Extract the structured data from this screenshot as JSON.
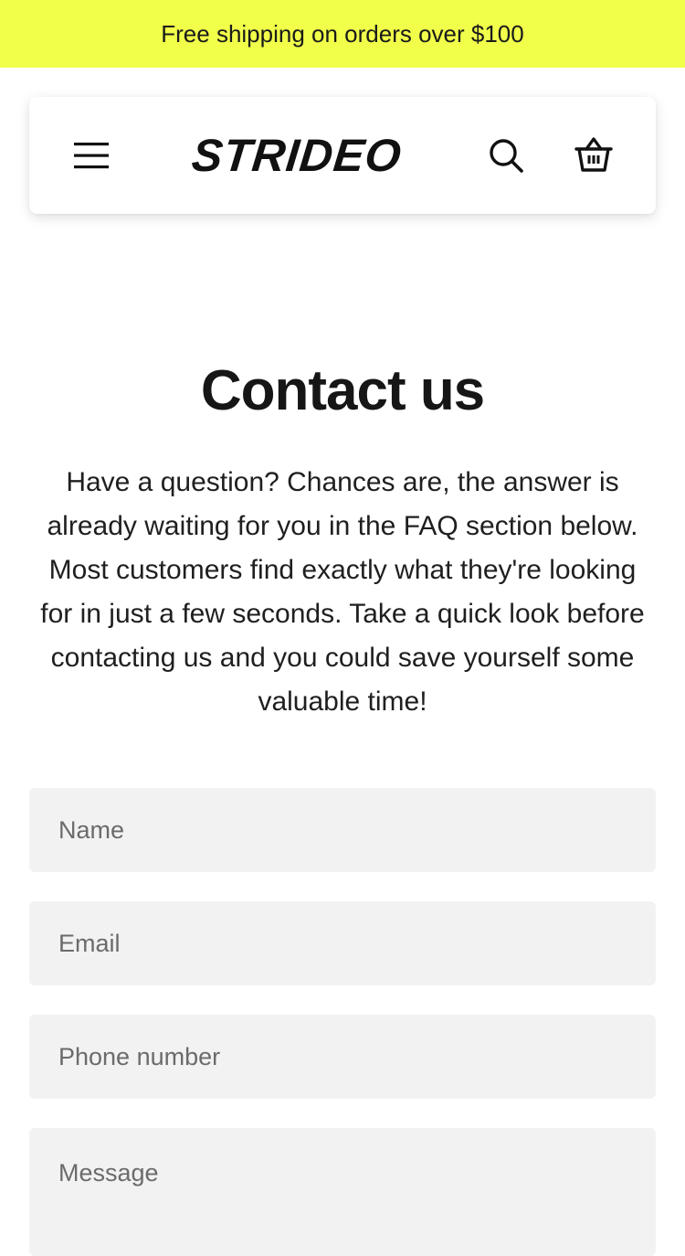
{
  "announcement": {
    "text": "Free shipping on orders over $100"
  },
  "header": {
    "logo": "STRIDEO",
    "icons": {
      "menu": "hamburger-menu-icon",
      "search": "search-icon",
      "cart": "shopping-basket-icon"
    }
  },
  "contact": {
    "title": "Contact us",
    "intro": "Have a question? Chances are, the answer is already waiting for you in the FAQ section below. Most customers find exactly what they're looking for in just a few seconds. Take a quick look before contacting us and you could save yourself some valuable time!"
  },
  "form": {
    "name_placeholder": "Name",
    "email_placeholder": "Email",
    "phone_placeholder": "Phone number",
    "message_placeholder": "Message"
  },
  "colors": {
    "announcement_bg": "#f1ff4a",
    "field_bg": "#f2f2f2",
    "text": "#1a1a1a"
  }
}
